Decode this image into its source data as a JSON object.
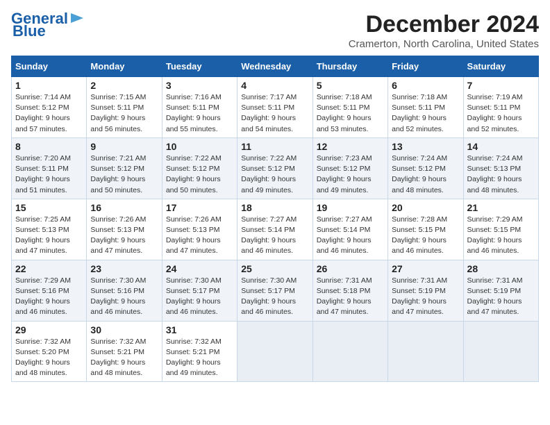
{
  "logo": {
    "line1": "General",
    "line2": "Blue"
  },
  "title": "December 2024",
  "subtitle": "Cramerton, North Carolina, United States",
  "days_of_week": [
    "Sunday",
    "Monday",
    "Tuesday",
    "Wednesday",
    "Thursday",
    "Friday",
    "Saturday"
  ],
  "weeks": [
    [
      {
        "day": 1,
        "sunrise": "7:14 AM",
        "sunset": "5:12 PM",
        "daylight": "9 hours and 57 minutes."
      },
      {
        "day": 2,
        "sunrise": "7:15 AM",
        "sunset": "5:11 PM",
        "daylight": "9 hours and 56 minutes."
      },
      {
        "day": 3,
        "sunrise": "7:16 AM",
        "sunset": "5:11 PM",
        "daylight": "9 hours and 55 minutes."
      },
      {
        "day": 4,
        "sunrise": "7:17 AM",
        "sunset": "5:11 PM",
        "daylight": "9 hours and 54 minutes."
      },
      {
        "day": 5,
        "sunrise": "7:18 AM",
        "sunset": "5:11 PM",
        "daylight": "9 hours and 53 minutes."
      },
      {
        "day": 6,
        "sunrise": "7:18 AM",
        "sunset": "5:11 PM",
        "daylight": "9 hours and 52 minutes."
      },
      {
        "day": 7,
        "sunrise": "7:19 AM",
        "sunset": "5:11 PM",
        "daylight": "9 hours and 52 minutes."
      }
    ],
    [
      {
        "day": 8,
        "sunrise": "7:20 AM",
        "sunset": "5:11 PM",
        "daylight": "9 hours and 51 minutes."
      },
      {
        "day": 9,
        "sunrise": "7:21 AM",
        "sunset": "5:12 PM",
        "daylight": "9 hours and 50 minutes."
      },
      {
        "day": 10,
        "sunrise": "7:22 AM",
        "sunset": "5:12 PM",
        "daylight": "9 hours and 50 minutes."
      },
      {
        "day": 11,
        "sunrise": "7:22 AM",
        "sunset": "5:12 PM",
        "daylight": "9 hours and 49 minutes."
      },
      {
        "day": 12,
        "sunrise": "7:23 AM",
        "sunset": "5:12 PM",
        "daylight": "9 hours and 49 minutes."
      },
      {
        "day": 13,
        "sunrise": "7:24 AM",
        "sunset": "5:12 PM",
        "daylight": "9 hours and 48 minutes."
      },
      {
        "day": 14,
        "sunrise": "7:24 AM",
        "sunset": "5:13 PM",
        "daylight": "9 hours and 48 minutes."
      }
    ],
    [
      {
        "day": 15,
        "sunrise": "7:25 AM",
        "sunset": "5:13 PM",
        "daylight": "9 hours and 47 minutes."
      },
      {
        "day": 16,
        "sunrise": "7:26 AM",
        "sunset": "5:13 PM",
        "daylight": "9 hours and 47 minutes."
      },
      {
        "day": 17,
        "sunrise": "7:26 AM",
        "sunset": "5:13 PM",
        "daylight": "9 hours and 47 minutes."
      },
      {
        "day": 18,
        "sunrise": "7:27 AM",
        "sunset": "5:14 PM",
        "daylight": "9 hours and 46 minutes."
      },
      {
        "day": 19,
        "sunrise": "7:27 AM",
        "sunset": "5:14 PM",
        "daylight": "9 hours and 46 minutes."
      },
      {
        "day": 20,
        "sunrise": "7:28 AM",
        "sunset": "5:15 PM",
        "daylight": "9 hours and 46 minutes."
      },
      {
        "day": 21,
        "sunrise": "7:29 AM",
        "sunset": "5:15 PM",
        "daylight": "9 hours and 46 minutes."
      }
    ],
    [
      {
        "day": 22,
        "sunrise": "7:29 AM",
        "sunset": "5:16 PM",
        "daylight": "9 hours and 46 minutes."
      },
      {
        "day": 23,
        "sunrise": "7:30 AM",
        "sunset": "5:16 PM",
        "daylight": "9 hours and 46 minutes."
      },
      {
        "day": 24,
        "sunrise": "7:30 AM",
        "sunset": "5:17 PM",
        "daylight": "9 hours and 46 minutes."
      },
      {
        "day": 25,
        "sunrise": "7:30 AM",
        "sunset": "5:17 PM",
        "daylight": "9 hours and 46 minutes."
      },
      {
        "day": 26,
        "sunrise": "7:31 AM",
        "sunset": "5:18 PM",
        "daylight": "9 hours and 47 minutes."
      },
      {
        "day": 27,
        "sunrise": "7:31 AM",
        "sunset": "5:19 PM",
        "daylight": "9 hours and 47 minutes."
      },
      {
        "day": 28,
        "sunrise": "7:31 AM",
        "sunset": "5:19 PM",
        "daylight": "9 hours and 47 minutes."
      }
    ],
    [
      {
        "day": 29,
        "sunrise": "7:32 AM",
        "sunset": "5:20 PM",
        "daylight": "9 hours and 48 minutes."
      },
      {
        "day": 30,
        "sunrise": "7:32 AM",
        "sunset": "5:21 PM",
        "daylight": "9 hours and 48 minutes."
      },
      {
        "day": 31,
        "sunrise": "7:32 AM",
        "sunset": "5:21 PM",
        "daylight": "9 hours and 49 minutes."
      },
      null,
      null,
      null,
      null
    ]
  ]
}
